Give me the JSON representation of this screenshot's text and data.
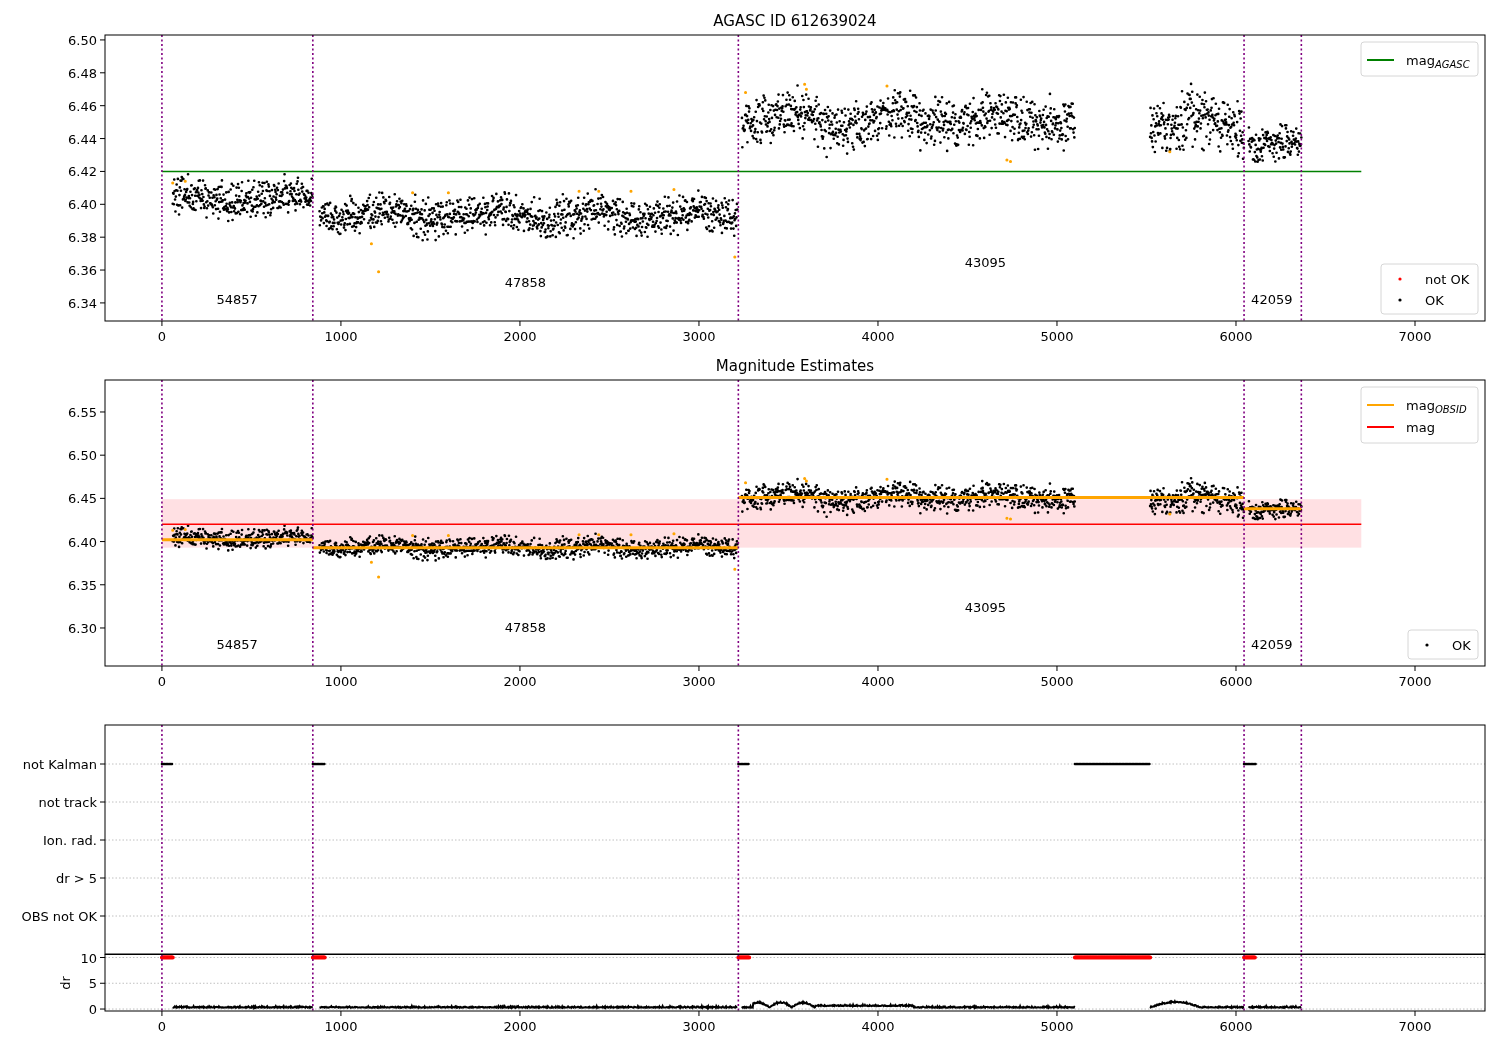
{
  "figure": {
    "panels": [
      {
        "chart_data": {
          "type": "line",
          "title": "AGASC ID 612639024",
          "xlim": [
            -318,
            7391
          ],
          "ylim": [
            6.329,
            6.503
          ],
          "xticks": [
            0,
            1000,
            2000,
            3000,
            4000,
            5000,
            6000,
            7000
          ],
          "yticks": [
            {
              "value": 6.34,
              "label": "6.34"
            },
            {
              "value": 6.36,
              "label": "6.36"
            },
            {
              "value": 6.38,
              "label": "6.38"
            },
            {
              "value": 6.4,
              "label": "6.40"
            },
            {
              "value": 6.42,
              "label": "6.42"
            },
            {
              "value": 6.44,
              "label": "6.44"
            },
            {
              "value": 6.46,
              "label": "6.46"
            },
            {
              "value": 6.48,
              "label": "6.48"
            },
            {
              "value": 6.5,
              "label": "6.50"
            }
          ],
          "series": [
            {
              "name": "mag$_{AGASC}$",
              "color": "#008000",
              "x": [
                0,
                6700
              ],
              "values": [
                6.42,
                6.42
              ]
            }
          ],
          "legend": "upper right",
          "ref_lines": [
            {
              "axis": "x",
              "value": 0,
              "color": "#800080"
            },
            {
              "axis": "x",
              "value": 843,
              "color": "#800080"
            },
            {
              "axis": "x",
              "value": 3220,
              "color": "#800080"
            },
            {
              "axis": "x",
              "value": 6045,
              "color": "#800080"
            },
            {
              "axis": "x",
              "value": 6365,
              "color": "#800080"
            }
          ],
          "annotations": [
            "54857",
            "47858",
            "43095",
            "42059"
          ]
        },
        "point_legend": [
          {
            "label": "not OK",
            "color": "#ff0000"
          },
          {
            "label": "OK",
            "color": "#000000"
          }
        ]
      },
      {
        "chart_data": {
          "type": "line",
          "title": "Magnitude Estimates",
          "xlim": [
            -318,
            7391
          ],
          "ylim": [
            6.256,
            6.587
          ],
          "xticks": [
            0,
            1000,
            2000,
            3000,
            4000,
            5000,
            6000,
            7000
          ],
          "yticks": [
            {
              "value": 6.3,
              "label": "6.30"
            },
            {
              "value": 6.35,
              "label": "6.35"
            },
            {
              "value": 6.4,
              "label": "6.40"
            },
            {
              "value": 6.45,
              "label": "6.45"
            },
            {
              "value": 6.5,
              "label": "6.50"
            },
            {
              "value": 6.55,
              "label": "6.55"
            }
          ],
          "series": [
            {
              "name": "mag$_{OBSID}$",
              "color": "#ffa500",
              "x": [
                0,
                843,
                null,
                843,
                3220,
                null,
                3220,
                6045,
                null,
                6045,
                6365
              ],
              "values": [
                6.402,
                6.402,
                null,
                6.393,
                6.393,
                null,
                6.451,
                6.451,
                null,
                6.438,
                6.438
              ]
            },
            {
              "name": "mag",
              "color": "#ff0000",
              "x": [
                0,
                6700
              ],
              "values": [
                6.42,
                6.42
              ]
            }
          ],
          "legend": "upper right",
          "bands": [
            {
              "axis": "y",
              "from": 6.393,
              "to": 6.449,
              "color": "#ffe0e3"
            }
          ],
          "ref_lines": [
            {
              "axis": "x",
              "value": 0,
              "color": "#800080"
            },
            {
              "axis": "x",
              "value": 843,
              "color": "#800080"
            },
            {
              "axis": "x",
              "value": 3220,
              "color": "#800080"
            },
            {
              "axis": "x",
              "value": 6045,
              "color": "#800080"
            },
            {
              "axis": "x",
              "value": 6365,
              "color": "#800080"
            }
          ],
          "annotations": [
            "54857",
            "47858",
            "43095",
            "42059"
          ]
        },
        "point_legend": [
          {
            "label": "OK",
            "color": "#000000"
          }
        ]
      },
      {
        "flag_rows": [
          "not Kalman",
          "not track",
          "Ion. rad.",
          "dr > 5",
          "OBS not OK"
        ]
      },
      {
        "chart_data": {
          "type": "line",
          "ylabel": "dr",
          "xlim": [
            -318,
            7391
          ],
          "ylim": [
            -0.38,
            10.58
          ],
          "xticks": [
            0,
            1000,
            2000,
            3000,
            4000,
            5000,
            6000,
            7000
          ],
          "yticks": [
            0,
            5,
            10
          ],
          "ref_lines": [
            {
              "axis": "x",
              "value": 0,
              "color": "#800080"
            },
            {
              "axis": "x",
              "value": 843,
              "color": "#800080"
            },
            {
              "axis": "x",
              "value": 3220,
              "color": "#800080"
            },
            {
              "axis": "x",
              "value": 6045,
              "color": "#800080"
            },
            {
              "axis": "x",
              "value": 6365,
              "color": "#800080"
            }
          ]
        }
      }
    ]
  }
}
